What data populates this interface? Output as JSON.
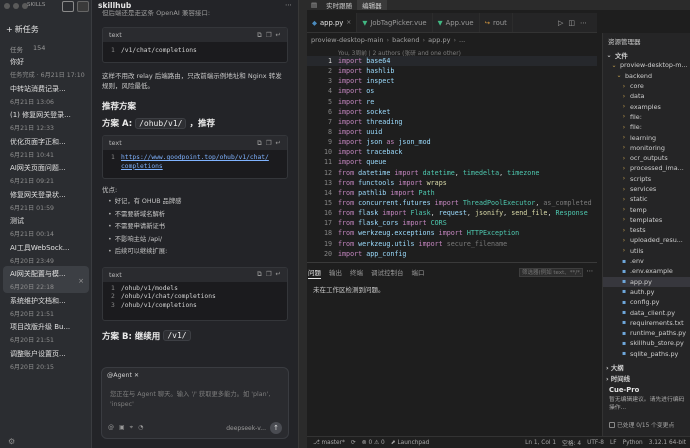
{
  "sidebar": {
    "brand": "SKILLS",
    "new_task": "新任务",
    "tasks_label": "任务",
    "tasks_count": "154",
    "tasks": [
      {
        "title": "你好",
        "date": "任务完成 · 6月21日 17:10",
        "active": false
      },
      {
        "title": "中转站消费记录...",
        "date": "6月21日 13:06",
        "active": false
      },
      {
        "title": "(1) 修复网关登录...",
        "date": "6月21日 12:33",
        "active": false
      },
      {
        "title": "优化页面字正和...",
        "date": "6月21日 10:41",
        "active": false
      },
      {
        "title": "AI网关页面问题...",
        "date": "6月21日 09:21",
        "active": false
      },
      {
        "title": "修复网关登录状...",
        "date": "6月21日 01:59",
        "active": false
      },
      {
        "title": "测试",
        "date": "6月21日 00:14",
        "active": false
      },
      {
        "title": "AI工具WebSock...",
        "date": "6月20日 23:49",
        "active": false
      },
      {
        "title": "AI网关配置与模...",
        "date": "6月20日 22:18",
        "active": true
      },
      {
        "title": "系统维护文档和...",
        "date": "6月20日 21:51",
        "active": false
      },
      {
        "title": "项目改版升级 Bu...",
        "date": "6月20日 21:51",
        "active": false
      },
      {
        "title": "调整账户设置页...",
        "date": "6月20日 20:15",
        "active": false
      }
    ]
  },
  "chat": {
    "title": "skillhub",
    "intro_text": "但后端还是走这条 OpenAI 兼容接口:",
    "code1": {
      "lang": "text",
      "lines": [
        "/v1/chat/completions"
      ]
    },
    "para1": "这样不用改 relay 后端路由，只改前端示例地址和 Nginx 转发规则，风险最低。",
    "rec_heading": "推荐方案",
    "plan_a_prefix": "方案 A:",
    "plan_a_code": "/ohub/v1/",
    "plan_a_suffix": "，推荐",
    "code2": {
      "lang": "text",
      "lines": [
        "https://www.goodpoint.top/ohub/v1/chat/",
        "completions"
      ]
    },
    "pros_label": "优点:",
    "bullets": [
      "好记，有 OHUB 品牌感",
      "不需要新域名解析",
      "不需要申请新证书",
      "不影响主站 /api/",
      "后续可以继续扩展:"
    ],
    "bullet_inline_code": "/api/",
    "code3": {
      "lang": "text",
      "lines": [
        "/ohub/v1/models",
        "/ohub/v1/chat/completions",
        "/ohub/v1/completions"
      ]
    },
    "plan_b_prefix": "方案 B: 继续用",
    "plan_b_code": "/v1/",
    "composer": {
      "agent": "@Agent",
      "placeholder": "您正在与 Agent 聊天。输入 '/' 获取更多能力。如 'plan', 'inspec'",
      "model": "deepseek-v..."
    }
  },
  "topbar": {
    "tabs": [
      "实时跟随",
      "编辑器"
    ]
  },
  "editor": {
    "tabs": [
      {
        "name": "app.py",
        "active": true,
        "icon": "python-icon"
      },
      {
        "name": "JobTagPicker.vue",
        "active": false,
        "icon": "vue-icon"
      },
      {
        "name": "App.vue",
        "active": false,
        "icon": "vue-icon"
      },
      {
        "name": "rout",
        "active": false,
        "icon": "route-icon"
      }
    ],
    "breadcrumb": [
      "proview-desktop-main",
      "backend",
      "app.py",
      "..."
    ],
    "blame": "You, 3周前 | 2 authors (张研 and one other)",
    "lines": [
      [
        [
          "kw",
          "import "
        ],
        [
          "mod",
          "base64"
        ]
      ],
      [
        [
          "kw",
          "import "
        ],
        [
          "mod",
          "hashlib"
        ]
      ],
      [
        [
          "kw",
          "import "
        ],
        [
          "mod",
          "inspect"
        ]
      ],
      [
        [
          "kw",
          "import "
        ],
        [
          "mod",
          "os"
        ]
      ],
      [
        [
          "kw",
          "import "
        ],
        [
          "mod",
          "re"
        ]
      ],
      [
        [
          "kw",
          "import "
        ],
        [
          "mod",
          "socket"
        ]
      ],
      [
        [
          "kw",
          "import "
        ],
        [
          "mod",
          "threading"
        ]
      ],
      [
        [
          "kw",
          "import "
        ],
        [
          "mod",
          "uuid"
        ]
      ],
      [
        [
          "kw",
          "import "
        ],
        [
          "mod",
          "json"
        ],
        [
          "kw",
          " as "
        ],
        [
          "mod",
          "json_mod"
        ]
      ],
      [
        [
          "kw",
          "import "
        ],
        [
          "mod",
          "traceback"
        ]
      ],
      [
        [
          "kw",
          "import "
        ],
        [
          "mod",
          "queue"
        ]
      ],
      [
        [
          "kw",
          "from "
        ],
        [
          "mod",
          "datetime"
        ],
        [
          "kw",
          " import "
        ],
        [
          "cls",
          "datetime"
        ],
        [
          "t",
          ", "
        ],
        [
          "cls",
          "timedelta"
        ],
        [
          "t",
          ", "
        ],
        [
          "cls",
          "timezone"
        ]
      ],
      [
        [
          "kw",
          "from "
        ],
        [
          "mod",
          "functools"
        ],
        [
          "kw",
          " import "
        ],
        [
          "fn",
          "wraps"
        ]
      ],
      [
        [
          "kw",
          "from "
        ],
        [
          "mod",
          "pathlib"
        ],
        [
          "kw",
          " import "
        ],
        [
          "cls",
          "Path"
        ]
      ],
      [
        [
          "kw",
          "from "
        ],
        [
          "mod",
          "concurrent.futures"
        ],
        [
          "kw",
          " import "
        ],
        [
          "cls",
          "ThreadPoolExecutor"
        ],
        [
          "t",
          ", "
        ],
        [
          "dim",
          "as_completed"
        ]
      ],
      [
        [
          "kw",
          "from "
        ],
        [
          "mod",
          "flask"
        ],
        [
          "kw",
          " import "
        ],
        [
          "cls",
          "Flask"
        ],
        [
          "t",
          ", "
        ],
        [
          "mod",
          "request"
        ],
        [
          "t",
          ", "
        ],
        [
          "fn",
          "jsonify"
        ],
        [
          "t",
          ", "
        ],
        [
          "fn",
          "send_file"
        ],
        [
          "t",
          ", "
        ],
        [
          "cls",
          "Response"
        ]
      ],
      [
        [
          "kw",
          "from "
        ],
        [
          "mod",
          "flask_cors"
        ],
        [
          "kw",
          " import "
        ],
        [
          "cls",
          "CORS"
        ]
      ],
      [
        [
          "kw",
          "from "
        ],
        [
          "mod",
          "werkzeug.exceptions"
        ],
        [
          "kw",
          " import "
        ],
        [
          "cls",
          "HTTPException"
        ]
      ],
      [
        [
          "kw",
          "from "
        ],
        [
          "mod",
          "werkzeug.utils"
        ],
        [
          "kw",
          " import "
        ],
        [
          "dim",
          "secure_filename"
        ]
      ],
      [
        [
          "kw",
          "import "
        ],
        [
          "mod",
          "app_config"
        ]
      ]
    ]
  },
  "panel": {
    "tabs": [
      "问题",
      "输出",
      "终端",
      "调试控制台",
      "端口"
    ],
    "active_tab": 0,
    "filter_placeholder": "筛选器(例如 text、**/*...",
    "message": "未在工作区检测到问题。"
  },
  "status": {
    "branch": "master*",
    "errors": "0",
    "warnings": "0",
    "launchpad": "Launchpad",
    "position": "Ln 1, Col 1",
    "spaces": "空格: 4",
    "encoding": "UTF-8",
    "eol": "LF",
    "language": "Python",
    "interpreter": "3.12.1 64-bit"
  },
  "explorer": {
    "title": "资源管理器",
    "sections": {
      "files": "文件",
      "outline": "大纲",
      "timeline": "时间线"
    },
    "tree": [
      {
        "name": "proview-desktop-m...",
        "type": "folder",
        "indent": 1
      },
      {
        "name": "backend",
        "type": "folder",
        "indent": 2
      },
      {
        "name": "core",
        "type": "folder",
        "indent": 3
      },
      {
        "name": "data",
        "type": "folder",
        "indent": 3
      },
      {
        "name": "examples",
        "type": "folder",
        "indent": 3
      },
      {
        "name": "file:",
        "type": "folder",
        "indent": 3
      },
      {
        "name": "file:",
        "type": "folder",
        "indent": 3
      },
      {
        "name": "learning",
        "type": "folder",
        "indent": 3
      },
      {
        "name": "monitoring",
        "type": "folder",
        "indent": 3
      },
      {
        "name": "ocr_outputs",
        "type": "folder",
        "indent": 3
      },
      {
        "name": "processed_ima...",
        "type": "folder",
        "indent": 3
      },
      {
        "name": "scripts",
        "type": "folder",
        "indent": 3
      },
      {
        "name": "services",
        "type": "folder",
        "indent": 3
      },
      {
        "name": "static",
        "type": "folder",
        "indent": 3
      },
      {
        "name": "temp",
        "type": "folder",
        "indent": 3
      },
      {
        "name": "templates",
        "type": "folder",
        "indent": 3
      },
      {
        "name": "tests",
        "type": "folder",
        "indent": 3
      },
      {
        "name": "uploaded_resu...",
        "type": "folder",
        "indent": 3
      },
      {
        "name": "utils",
        "type": "folder",
        "indent": 3
      },
      {
        "name": ".env",
        "type": "file",
        "indent": 3
      },
      {
        "name": ".env.example",
        "type": "file",
        "indent": 3
      },
      {
        "name": "app.py",
        "type": "file",
        "indent": 3,
        "selected": true
      },
      {
        "name": "auth.py",
        "type": "file",
        "indent": 3
      },
      {
        "name": "config.py",
        "type": "file",
        "indent": 3
      },
      {
        "name": "data_client.py",
        "type": "file",
        "indent": 3
      },
      {
        "name": "requirements.txt",
        "type": "file",
        "indent": 3
      },
      {
        "name": "runtime_paths.py",
        "type": "file",
        "indent": 3
      },
      {
        "name": "skillhub_store.py",
        "type": "file",
        "indent": 3
      },
      {
        "name": "sqlite_paths.py",
        "type": "file",
        "indent": 3
      }
    ]
  },
  "cue": {
    "title": "Cue-Pro",
    "desc": "暂无编辑建议。请先进行编码操作...",
    "status": "已处理 0/15 个变更点"
  }
}
